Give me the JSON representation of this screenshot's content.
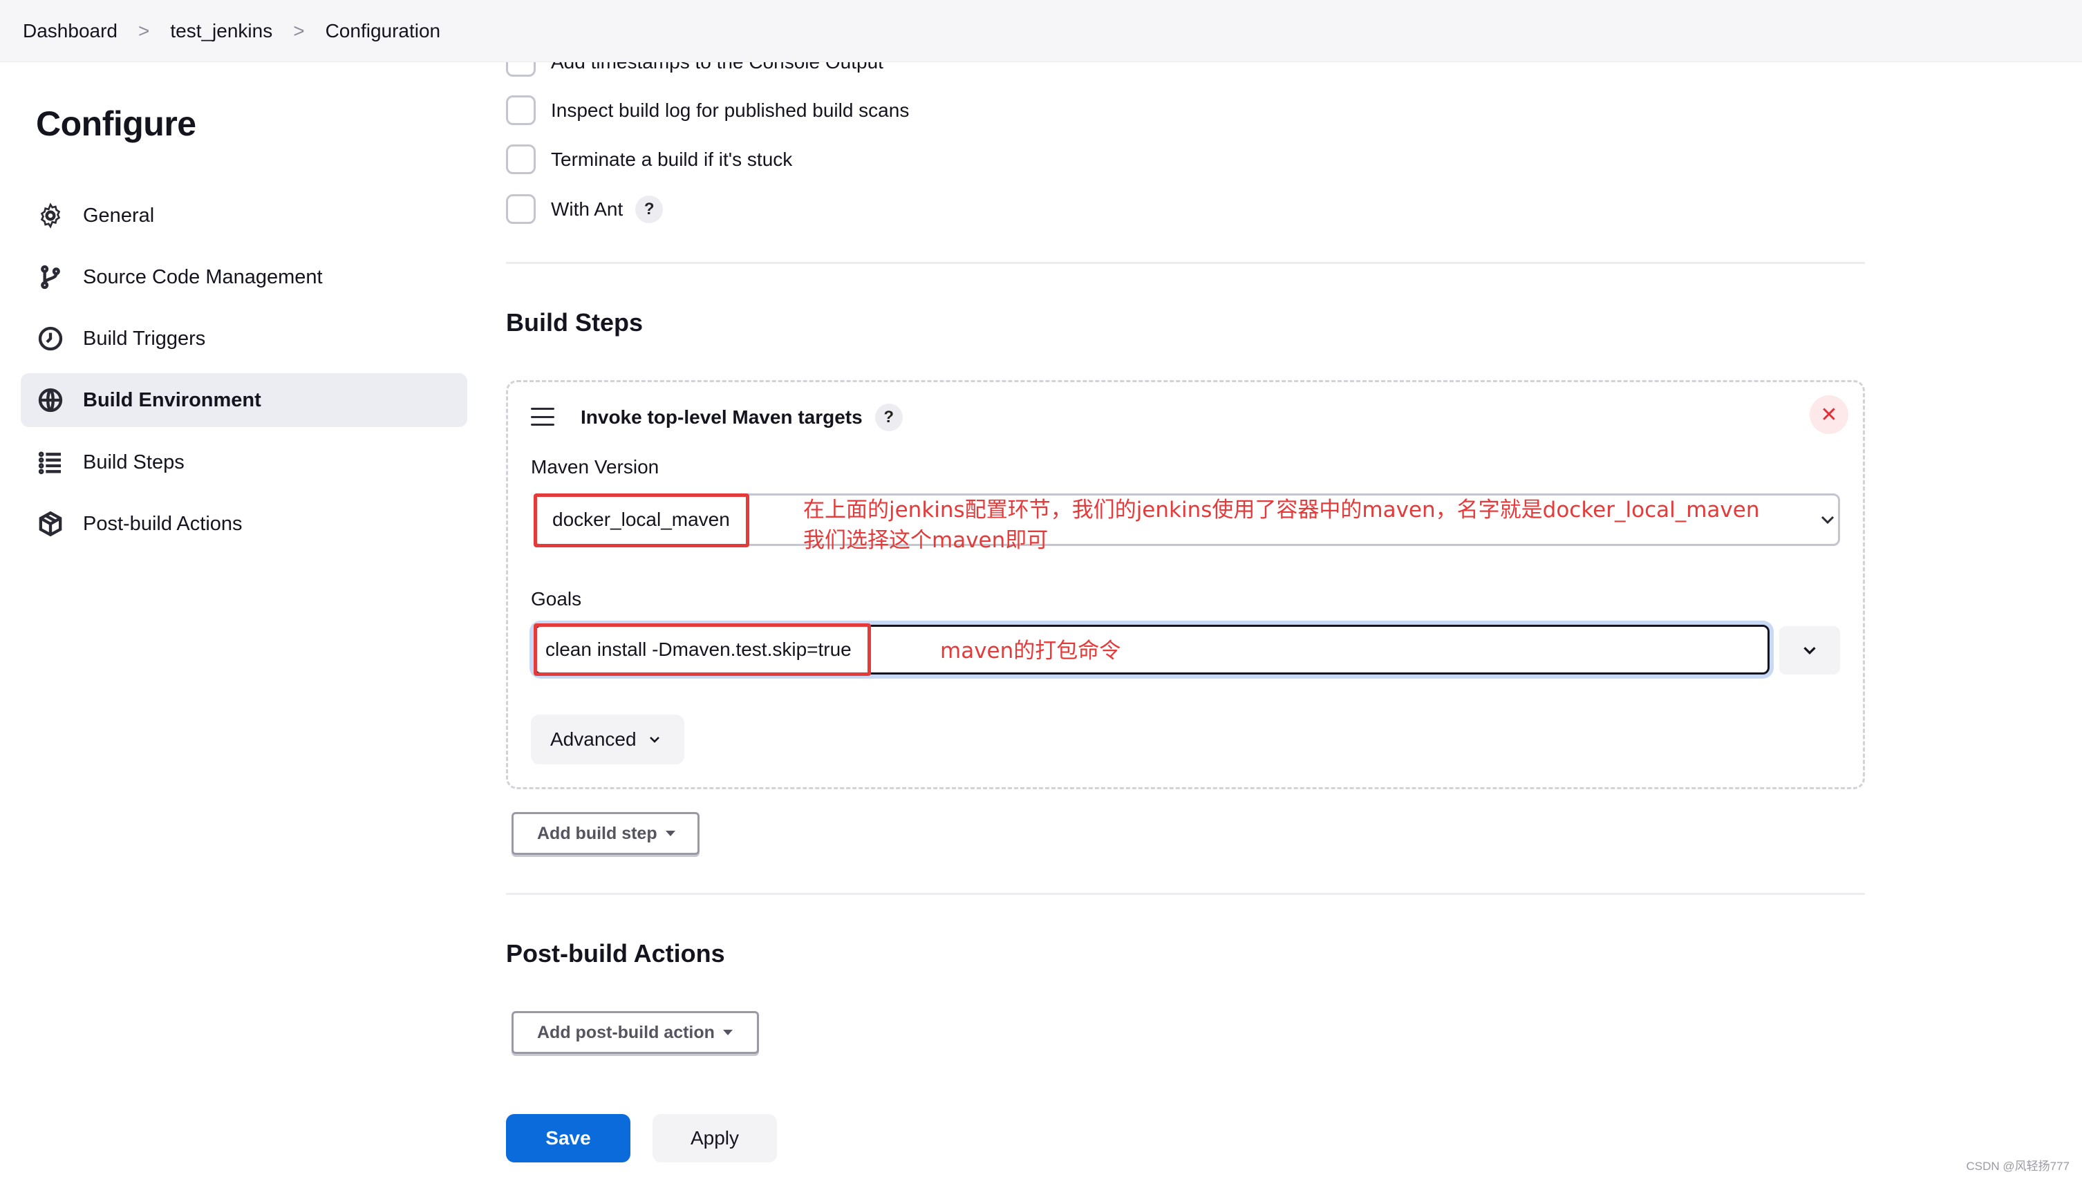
{
  "breadcrumb": {
    "items": [
      "Dashboard",
      "test_jenkins",
      "Configuration"
    ],
    "separator": ">"
  },
  "sidebar": {
    "title": "Configure",
    "items": [
      {
        "label": "General",
        "icon": "gear-icon"
      },
      {
        "label": "Source Code Management",
        "icon": "branch-icon"
      },
      {
        "label": "Build Triggers",
        "icon": "clock-icon"
      },
      {
        "label": "Build Environment",
        "icon": "globe-icon",
        "active": true
      },
      {
        "label": "Build Steps",
        "icon": "list-icon"
      },
      {
        "label": "Post-build Actions",
        "icon": "package-icon"
      }
    ]
  },
  "build_env": {
    "options": [
      {
        "label": "Add timestamps to the Console Output",
        "checked": false
      },
      {
        "label": "Inspect build log for published build scans",
        "checked": false
      },
      {
        "label": "Terminate a build if it's stuck",
        "checked": false
      },
      {
        "label": "With Ant",
        "checked": false
      }
    ],
    "help_glyph": "?"
  },
  "build_steps": {
    "title": "Build Steps",
    "step": {
      "title": "Invoke top-level Maven targets",
      "close_glyph": "✕",
      "maven_version_label": "Maven Version",
      "maven_version_value": "docker_local_maven",
      "goals_label": "Goals",
      "goals_value": "clean install -Dmaven.test.skip=true",
      "advanced_label": "Advanced"
    },
    "add_button": "Add build step"
  },
  "post_build": {
    "title": "Post-build Actions",
    "add_button": "Add post-build action"
  },
  "footer": {
    "save": "Save",
    "apply": "Apply"
  },
  "annotations": {
    "maven_line1": "在上面的jenkins配置环节，我们的jenkins使用了容器中的maven，名字就是docker_local_maven",
    "maven_line2": "我们选择这个maven即可",
    "goals_note": "maven的打包命令"
  },
  "watermark": "CSDN @风轻扬777",
  "colors": {
    "primary": "#0b6bdb",
    "annotation_red": "#e53a3a",
    "danger": "#e0303a",
    "active_nav_bg": "#ececf3"
  }
}
